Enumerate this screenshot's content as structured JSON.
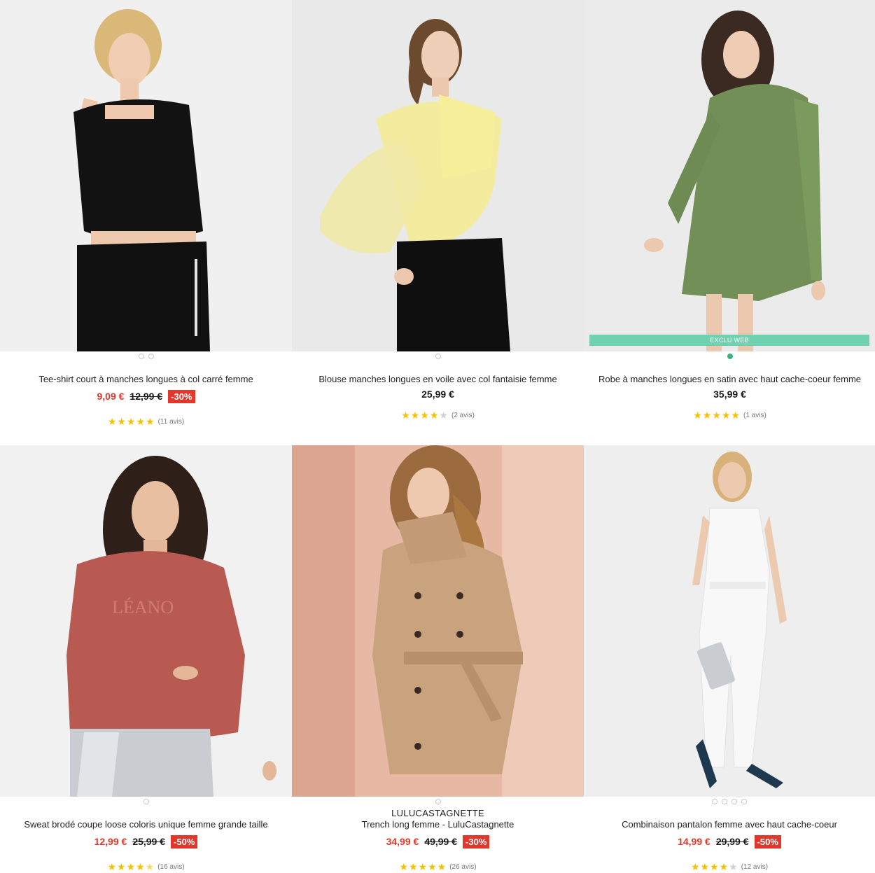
{
  "products": [
    {
      "title": "Tee-shirt court à manches longues à col carré femme",
      "price_now": "9,09 €",
      "price_old": "12,99 €",
      "discount": "-30%",
      "rating_stars": 5,
      "rating_text": "(11 avis)",
      "image_dots": 2
    },
    {
      "title": "Blouse manches longues en voile avec col fantaisie femme",
      "price_now": "25,99 €",
      "rating_stars": 4,
      "rating_text": "(2 avis)",
      "image_dots": 1
    },
    {
      "title": "Robe à manches longues en satin avec haut cache-coeur femme",
      "price_now": "35,99 €",
      "rating_stars": 5,
      "rating_text": "(1 avis)",
      "badge_label": "EXCLU WEB",
      "image_dots": 1
    },
    {
      "title": "Sweat brodé coupe loose coloris unique femme grande taille",
      "price_now": "12,99 €",
      "price_old": "25,99 €",
      "discount": "-50%",
      "rating_stars": 4.5,
      "rating_text": "(16 avis)",
      "image_dots": 1
    },
    {
      "brand": "LULUCASTAGNETTE",
      "title": "Trench long femme - LuluCastagnette",
      "price_now": "34,99 €",
      "price_old": "49,99 €",
      "discount": "-30%",
      "rating_stars": 5,
      "rating_text": "(26 avis)",
      "image_dots": 1
    },
    {
      "title": "Combinaison pantalon femme avec haut cache-coeur",
      "price_now": "14,99 €",
      "price_old": "29,99 €",
      "discount": "-50%",
      "rating_stars": 4,
      "rating_text": "(12 avis)",
      "image_dots": 4
    }
  ],
  "colors": {
    "sale_red": "#e2372b",
    "star_gold": "#f2c200",
    "exclu_green": "#6fd1b0",
    "dot_active_green": "#3db082"
  }
}
